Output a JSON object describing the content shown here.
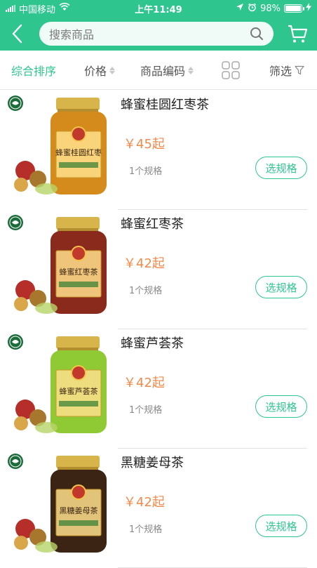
{
  "status_bar": {
    "carrier": "中国移动",
    "time": "上午11:49",
    "battery": "98%",
    "battery_level": 0.98
  },
  "nav": {
    "search_placeholder": "搜索商品"
  },
  "filters": {
    "sort": "综合排序",
    "price": "价格",
    "code": "商品编码",
    "filter": "筛选"
  },
  "colors": {
    "accent": "#2ec58f",
    "price": "#f08a4b"
  },
  "products": [
    {
      "name": "蜂蜜桂圆红枣茶",
      "price": "￥45起",
      "spec_count": "1个规格",
      "action": "选规格",
      "jar_label": "蜂蜜桂圆红枣",
      "jar_color": "#d58a1c",
      "lid_color": "#d8b54a"
    },
    {
      "name": "蜂蜜红枣茶",
      "price": "￥42起",
      "spec_count": "1个规格",
      "action": "选规格",
      "jar_label": "蜂蜜红枣茶",
      "jar_color": "#8a2a1c",
      "lid_color": "#d8b54a"
    },
    {
      "name": "蜂蜜芦荟茶",
      "price": "￥42起",
      "spec_count": "1个规格",
      "action": "选规格",
      "jar_label": "蜂蜜芦荟茶",
      "jar_color": "#8fc934",
      "lid_color": "#d8b54a"
    },
    {
      "name": "黑糖姜母茶",
      "price": "￥42起",
      "spec_count": "1个规格",
      "action": "选规格",
      "jar_label": "黑糖姜母茶",
      "jar_color": "#3b2413",
      "lid_color": "#d8b54a"
    }
  ]
}
